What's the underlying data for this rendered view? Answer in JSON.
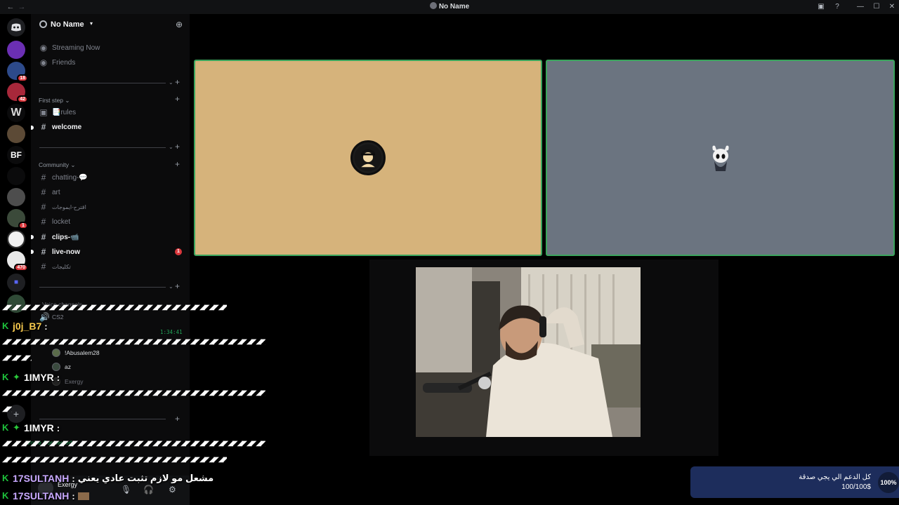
{
  "window": {
    "title": "No Name"
  },
  "sidebar": {
    "server_name": "No Name",
    "top_items": [
      {
        "label": "Streaming Now"
      },
      {
        "label": "Friends"
      }
    ],
    "categories": {
      "first_step": "First step",
      "community": "Community"
    },
    "first_step_channels": [
      {
        "label": "📑rules"
      },
      {
        "label": "welcome"
      }
    ],
    "community_channels": [
      {
        "label": "chatting-💬"
      },
      {
        "label": "art"
      },
      {
        "label": "اقترح-ايموجات"
      },
      {
        "label": "locket"
      },
      {
        "label": "clips-📹"
      },
      {
        "label": "live-now",
        "mentions": "1"
      },
      {
        "label": "تكليجات"
      }
    ],
    "voice": {
      "category": "Voice channels",
      "channel": "CS2",
      "timer": "1:34:41",
      "users": [
        "!Abusalem28",
        "az",
        "Exergy"
      ]
    },
    "voice_connected": "Voice Connected",
    "user_panel": {
      "username": "Exergy"
    }
  },
  "server_badges": [
    "18",
    "42",
    "1",
    "470"
  ],
  "chat": {
    "lines": [
      {
        "nick": "j0j_B7",
        "sep": ":",
        "msg": "",
        "color": "#f5c84d"
      },
      {
        "nick": "1IMYR",
        "sep": ":",
        "msg": "",
        "color": "#ffffff"
      },
      {
        "nick": "1IMYR",
        "sep": ":",
        "msg": "",
        "color": "#ffffff"
      },
      {
        "nick": "17SULTANH",
        "sep": ":",
        "msg": "مشعل مو لازم تثبت عادي يعني",
        "color": "#c9a9ff"
      },
      {
        "nick": "17SULTANH",
        "sep": ":",
        "msg": "",
        "color": "#c9a9ff"
      }
    ]
  },
  "donation": {
    "title": "كل الدعم الي يجي صدقة",
    "value": "100/100$",
    "percent": "100%",
    "progress": 1.0
  },
  "colors": {
    "speaking_border": "#3ba55d",
    "tile1_bg": "#d6b37b",
    "tile2_bg": "#6b7480"
  }
}
